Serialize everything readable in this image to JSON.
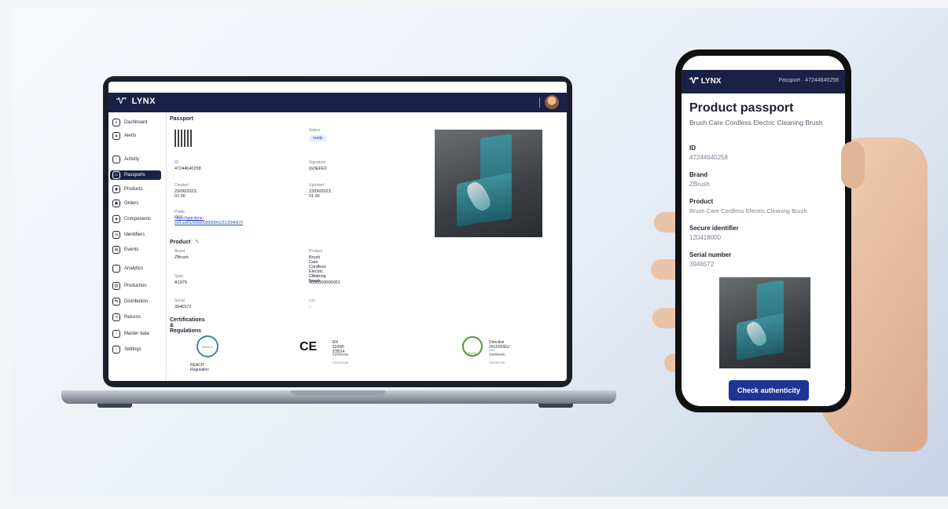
{
  "app": {
    "logo_symbol": "Ꮙ",
    "name": "LYNX"
  },
  "sidebar": {
    "items": [
      {
        "icon": "dashboard-icon",
        "glyph": "≡",
        "label": "Dashboard"
      },
      {
        "icon": "alerts-icon",
        "glyph": "▲",
        "label": "Alerts"
      },
      {
        "icon": "activity-icon",
        "glyph": "·",
        "label": "Activity"
      },
      {
        "icon": "passports-icon",
        "glyph": "▭",
        "label": "Passports",
        "active": true
      },
      {
        "icon": "products-icon",
        "glyph": "◆",
        "label": "Products"
      },
      {
        "icon": "orders-icon",
        "glyph": "▣",
        "label": "Orders"
      },
      {
        "icon": "components-icon",
        "glyph": "◈",
        "label": "Components"
      },
      {
        "icon": "identifiers-icon",
        "glyph": "◎",
        "label": "Identifiers"
      },
      {
        "icon": "events-icon",
        "glyph": "▤",
        "label": "Events"
      },
      {
        "icon": "analytics-icon",
        "glyph": "·",
        "label": "Analytics"
      },
      {
        "icon": "production-icon",
        "glyph": "▥",
        "label": "Production"
      },
      {
        "icon": "distribution-icon",
        "glyph": "⇆",
        "label": "Distribution"
      },
      {
        "icon": "returns-icon",
        "glyph": "↺",
        "label": "Returns"
      },
      {
        "icon": "master-data-icon",
        "glyph": "›",
        "label": "Master data"
      },
      {
        "icon": "settings-icon",
        "glyph": "›",
        "label": "Settings"
      }
    ]
  },
  "passport": {
    "heading": "Passport",
    "status_label": "Status",
    "status_value": "ready",
    "id_label": "ID",
    "id_value": "47244640258",
    "signature_label": "Signature",
    "signature_value": "0x0EFE0",
    "created_label": "Created",
    "created_value": "23/06/2023, 01:36",
    "updated_label": "Updated",
    "updated_value": "23/06/2023, 01:36",
    "public_view_label": "Public View",
    "public_view_url": "https://app.dyne-soft.us/01/9000000000001/21/3946572"
  },
  "product": {
    "heading": "Product",
    "brand_label": "Brand",
    "brand_value": "ZBrush",
    "product_label": "Product",
    "product_value": "Brush Care Cordless Electric Cleaning Brush",
    "spec_label": "Spec",
    "spec_value": "A1975",
    "gtin_label": "GTIN",
    "gtin_value": "9000000000001",
    "serial_label": "Serial",
    "serial_value": "3946572",
    "lot_label": "Lot",
    "lot_value": "-"
  },
  "certifications": {
    "heading": "Certifications & Regulations",
    "reach_badge": "REACH",
    "reach_caption": "REACH Regulation",
    "ce_mark": "CE",
    "ce_title": "EN 62368-1:2014",
    "ce_sub1": "Also Certificates",
    "ce_sub2": "23/03/2026 - 23/03/2026",
    "rohs_badge": "RoHS",
    "rohs_title": "Directive 2011/65/EU",
    "rohs_sub1": "Also Certificates",
    "rohs_sub2": "23/03/2026 - 23/03/2026"
  },
  "phone": {
    "logo": "LYNX",
    "header_text": "Passport · 47244640258",
    "title": "Product passport",
    "subtitle": "Brush Care Cordless Electric Cleaning Brush",
    "fields": [
      {
        "label": "ID",
        "value": "47244640258"
      },
      {
        "label": "Brand",
        "value": "ZBrush"
      },
      {
        "label": "Product",
        "value": "Brush Care Cordless Electric Cleaning Brush"
      },
      {
        "label": "Secure identifier",
        "value": "120418000"
      },
      {
        "label": "Serial number",
        "value": "3946572"
      }
    ],
    "button": "Check authenticity"
  }
}
